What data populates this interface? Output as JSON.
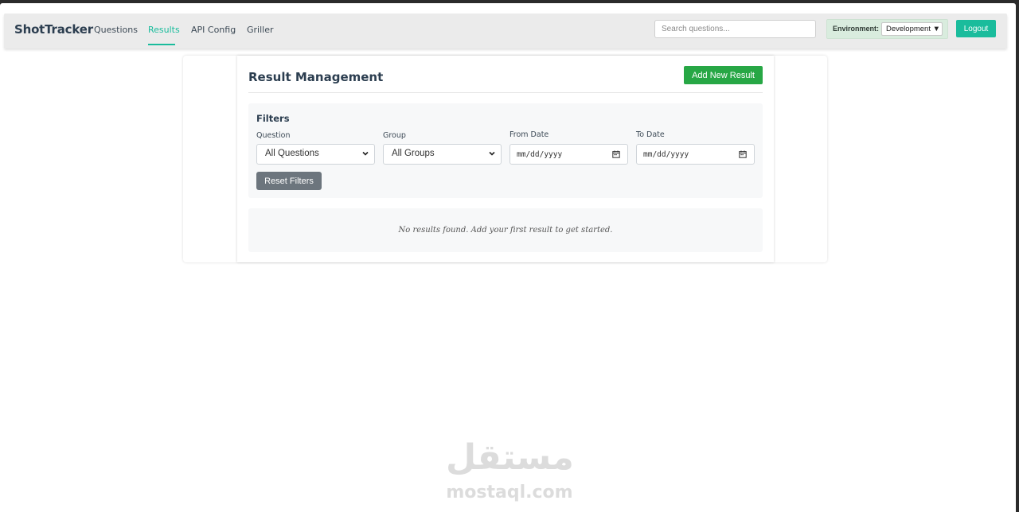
{
  "navbar": {
    "brand": "ShotTracker",
    "links": [
      {
        "label": "Questions",
        "active": false
      },
      {
        "label": "Results",
        "active": true
      },
      {
        "label": "API Config",
        "active": false
      },
      {
        "label": "Griller",
        "active": false
      }
    ],
    "search": {
      "placeholder": "Search questions...",
      "value": ""
    },
    "environment": {
      "label": "Environment:",
      "value": "Development ▼"
    },
    "logout_label": "Logout"
  },
  "page": {
    "title": "Result Management",
    "add_button_label": "Add New Result"
  },
  "filters": {
    "title": "Filters",
    "question": {
      "label": "Question",
      "value": "All Questions"
    },
    "group": {
      "label": "Group",
      "value": "All Groups"
    },
    "from_date": {
      "label": "From Date",
      "placeholder": "mm/dd/yyyy"
    },
    "to_date": {
      "label": "To Date",
      "placeholder": "mm/dd/yyyy"
    },
    "reset_label": "Reset Filters"
  },
  "empty_state": "No results found. Add your first result to get started.",
  "watermark": {
    "arabic": "مستقل",
    "latin": "mostaql.com"
  },
  "colors": {
    "accent": "#1abc9c",
    "success": "#27a745",
    "secondary": "#6c757d",
    "text": "#2c3e50"
  },
  "icons": [
    "chevron-down-icon",
    "calendar-icon"
  ]
}
